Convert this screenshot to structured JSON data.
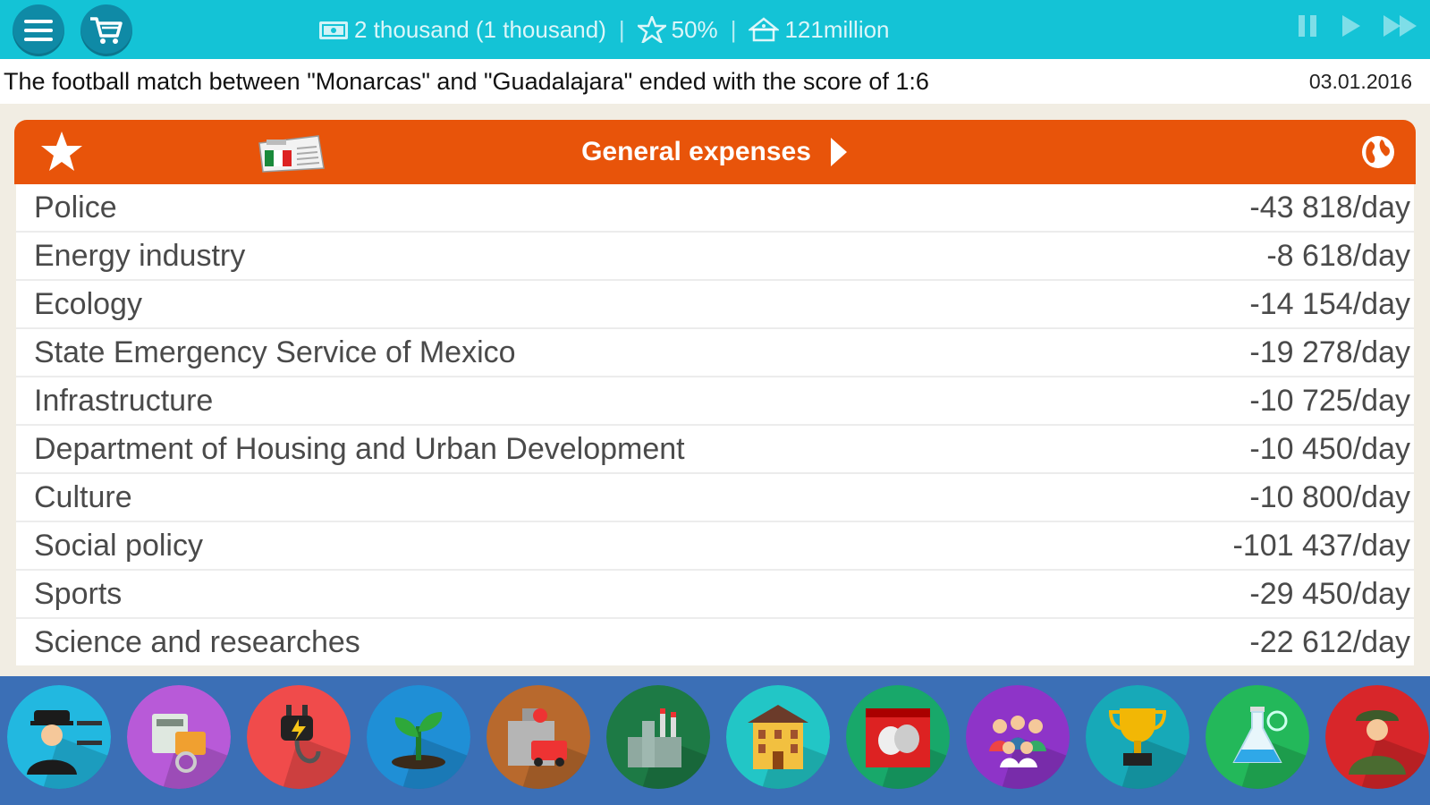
{
  "topbar": {
    "money": "2 thousand (1 thousand)",
    "rating": "50%",
    "population": "121million",
    "sep": "|"
  },
  "news": {
    "headline": "The football match between  \"Monarcas\" and \"Guadalajara\" ended with the score of 1:6",
    "date": "03.01.2016"
  },
  "panel": {
    "title": "General expenses"
  },
  "expenses": [
    {
      "name": "Police",
      "amount": "-43 818/day"
    },
    {
      "name": "Energy industry",
      "amount": "-8 618/day"
    },
    {
      "name": "Ecology",
      "amount": "-14 154/day"
    },
    {
      "name": "State Emergency Service of Mexico",
      "amount": "-19 278/day"
    },
    {
      "name": "Infrastructure",
      "amount": "-10 725/day"
    },
    {
      "name": "Department of Housing and Urban Development",
      "amount": "-10 450/day"
    },
    {
      "name": "Culture",
      "amount": "-10 800/day"
    },
    {
      "name": "Social policy",
      "amount": "-101 437/day"
    },
    {
      "name": "Sports",
      "amount": "-29 450/day"
    },
    {
      "name": "Science and researches",
      "amount": "-22 612/day"
    }
  ],
  "categories": [
    {
      "icon": "police-icon",
      "color": "#22b8e0"
    },
    {
      "icon": "energy-icon",
      "color": "#b85ad8"
    },
    {
      "icon": "power-plug-icon",
      "color": "#f04b4b"
    },
    {
      "icon": "ecology-sprout-icon",
      "color": "#1f8fd6"
    },
    {
      "icon": "fire-station-icon",
      "color": "#b8692d"
    },
    {
      "icon": "factory-icon",
      "color": "#1d7a45"
    },
    {
      "icon": "housing-icon",
      "color": "#22c6c6"
    },
    {
      "icon": "theater-masks-icon",
      "color": "#18a86a"
    },
    {
      "icon": "people-icon",
      "color": "#8e34c8"
    },
    {
      "icon": "trophy-icon",
      "color": "#17a9b8"
    },
    {
      "icon": "science-flask-icon",
      "color": "#23b85a"
    },
    {
      "icon": "soldier-icon",
      "color": "#d8262a"
    }
  ]
}
